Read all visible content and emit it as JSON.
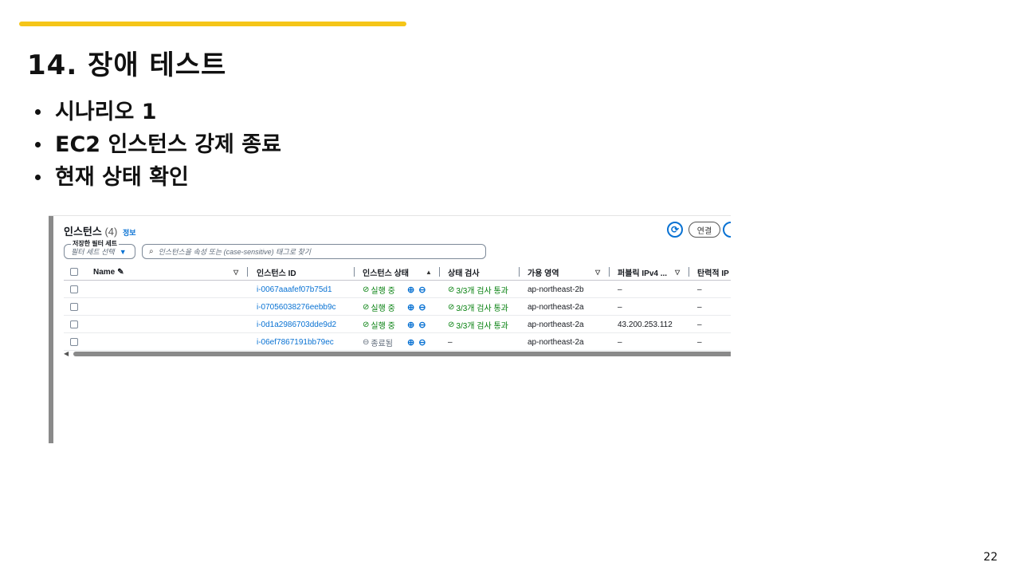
{
  "slide": {
    "title": "14. 장애 테스트",
    "bullets": [
      "시나리오 1",
      "EC2 인스턴스 강제 종료",
      "현재 상태 확인"
    ],
    "page_number": "22",
    "accent_color": "#f5c518"
  },
  "console": {
    "header": {
      "title": "인스턴스",
      "count": "(4)",
      "info": "정보"
    },
    "actions": {
      "refresh_icon": "refresh-icon",
      "connect_label": "연결"
    },
    "filter": {
      "legend": "저장한 필터 세트",
      "select_placeholder": "필터 세트 선택",
      "search_placeholder": "인스턴스을 속성 또는 (case-sensitive) 태그로 찾기"
    },
    "columns": [
      "Name",
      "인스턴스 ID",
      "인스턴스 상태",
      "상태 검사",
      "가용 영역",
      "퍼블릭 IPv4 ...",
      "탄력적 IP"
    ],
    "rows": [
      {
        "name": "",
        "id": "i-0067aaafef07b75d1",
        "state": "실행 중",
        "state_kind": "running",
        "check": "3/3개 검사 통과",
        "az": "ap-northeast-2b",
        "ipv4": "–",
        "eip": "–"
      },
      {
        "name": "",
        "id": "i-07056038276eebb9c",
        "state": "실행 중",
        "state_kind": "running",
        "check": "3/3개 검사 통과",
        "az": "ap-northeast-2a",
        "ipv4": "–",
        "eip": "–"
      },
      {
        "name": "",
        "id": "i-0d1a2986703dde9d2",
        "state": "실행 중",
        "state_kind": "running",
        "check": "3/3개 검사 통과",
        "az": "ap-northeast-2a",
        "ipv4": "43.200.253.112",
        "eip": "–"
      },
      {
        "name": "",
        "id": "i-06ef7867191bb79ec",
        "state": "종료됨",
        "state_kind": "terminated",
        "check": "–",
        "az": "ap-northeast-2a",
        "ipv4": "–",
        "eip": "–"
      }
    ]
  }
}
